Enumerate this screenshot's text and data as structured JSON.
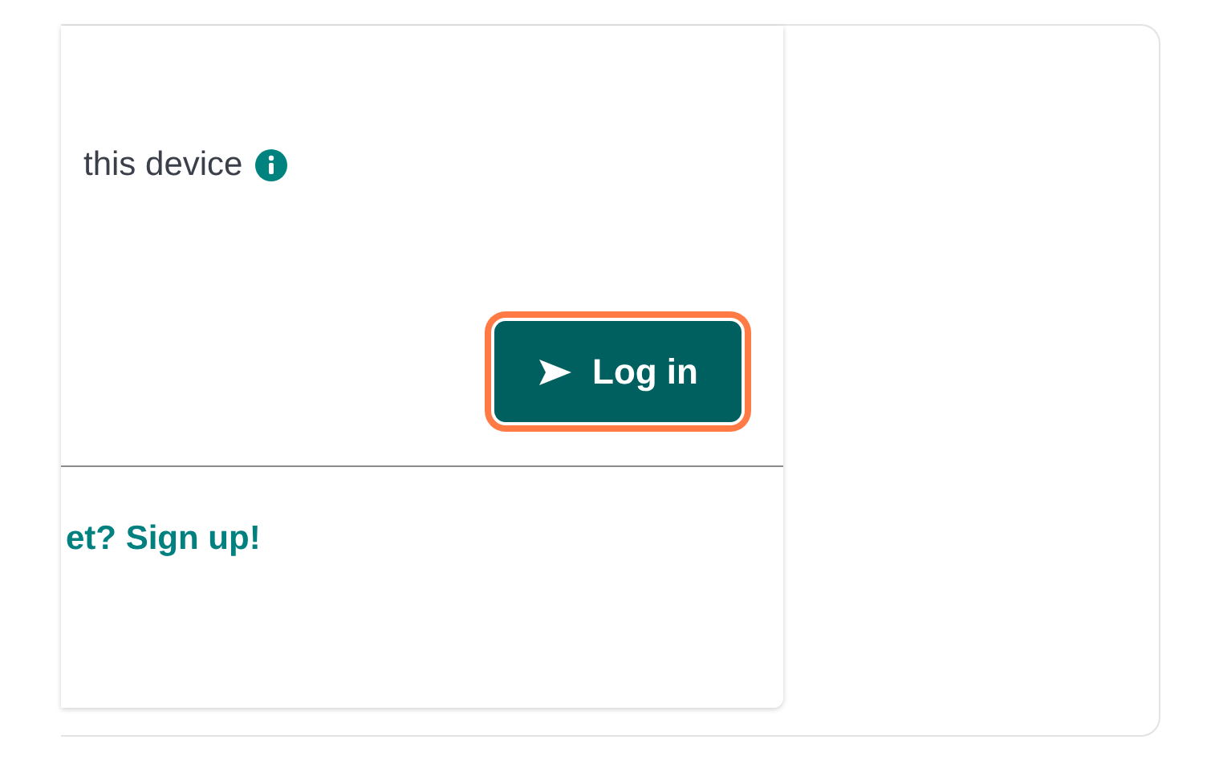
{
  "remember": {
    "label": "this device"
  },
  "login_button": {
    "label": "Log in",
    "focused": true
  },
  "signup": {
    "prefix": "et? ",
    "link": "Sign up!"
  }
}
